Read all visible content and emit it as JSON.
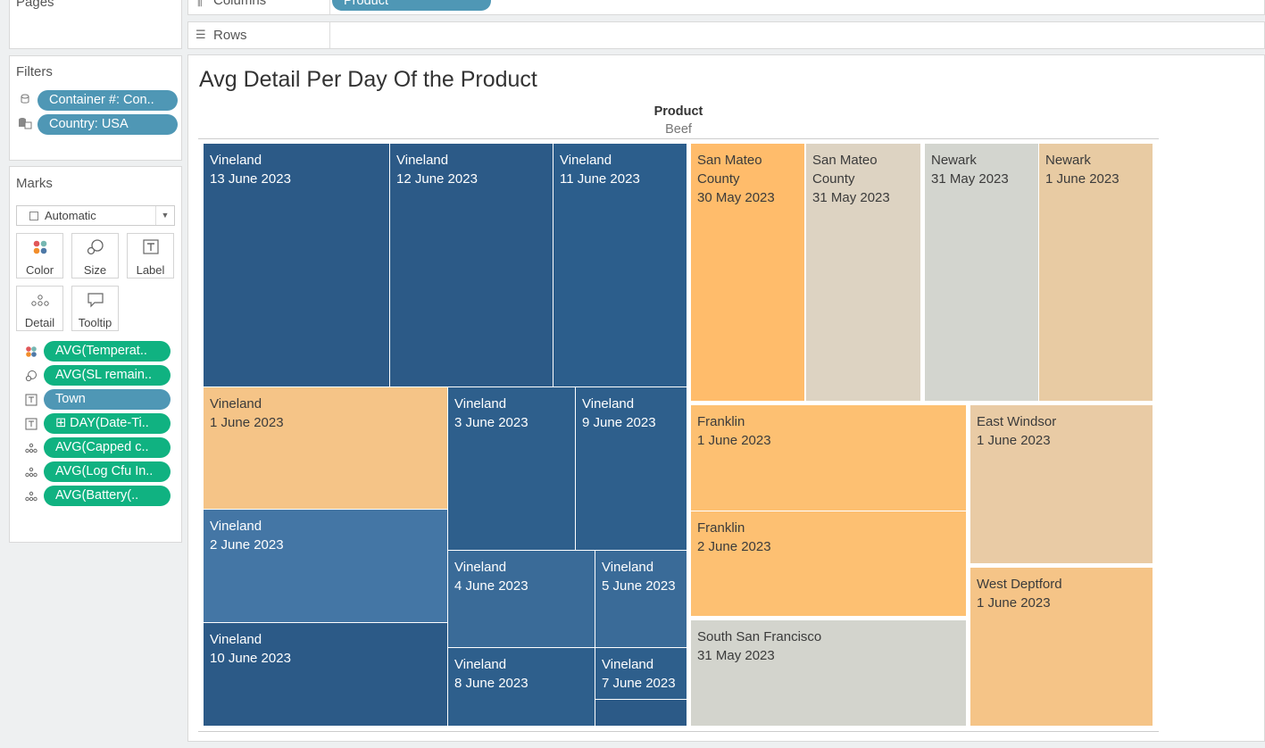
{
  "shelves": {
    "pages_label": "Pages",
    "columns_label": "Columns",
    "columns_pill": "Product",
    "rows_label": "Rows"
  },
  "filters": {
    "title": "Filters",
    "items": [
      "Container #: Con..",
      "Country: USA"
    ]
  },
  "marks": {
    "title": "Marks",
    "type_select": "Automatic",
    "buttons": [
      "Color",
      "Size",
      "Label",
      "Detail",
      "Tooltip"
    ],
    "pills": [
      {
        "icon": "color-icon",
        "label": "AVG(Temperat..",
        "kind": "green"
      },
      {
        "icon": "size-icon",
        "label": "AVG(SL remain..",
        "kind": "green"
      },
      {
        "icon": "label-icon",
        "label": "Town",
        "kind": "blue"
      },
      {
        "icon": "label-icon",
        "label": "⊞ DAY(Date-Ti..",
        "kind": "green"
      },
      {
        "icon": "detail-icon",
        "label": "AVG(Capped c..",
        "kind": "green"
      },
      {
        "icon": "detail-icon",
        "label": "AVG(Log Cfu In..",
        "kind": "green"
      },
      {
        "icon": "detail-icon",
        "label": "AVG(Battery(..",
        "kind": "green"
      }
    ]
  },
  "view": {
    "title": "Avg Detail Per Day Of the Product",
    "header_field": "Product",
    "header_value": "Beef"
  },
  "treemap": [
    {
      "town": "Vineland",
      "date": "13 June 2023",
      "color": "#2c5a87"
    },
    {
      "town": "Vineland",
      "date": "12 June 2023",
      "color": "#2c5a87"
    },
    {
      "town": "Vineland",
      "date": "11 June 2023",
      "color": "#2c5e8c"
    },
    {
      "town": "Vineland",
      "date": "1 June 2023",
      "color": "#f5c487"
    },
    {
      "town": "Vineland",
      "date": "3 June 2023",
      "color": "#2e5f8c"
    },
    {
      "town": "Vineland",
      "date": "9 June 2023",
      "color": "#2e5f8c"
    },
    {
      "town": "Vineland",
      "date": "2 June 2023",
      "color": "#4476a5"
    },
    {
      "town": "Vineland",
      "date": "4 June 2023",
      "color": "#3a6b98"
    },
    {
      "town": "Vineland",
      "date": "5 June 2023",
      "color": "#3a6b98"
    },
    {
      "town": "Vineland",
      "date": "10 June 2023",
      "color": "#2c5a87"
    },
    {
      "town": "Vineland",
      "date": "8 June 2023",
      "color": "#2e5f8c"
    },
    {
      "town": "Vineland",
      "date": "7 June 2023",
      "color": "#2e5f8c"
    },
    {
      "town": "",
      "date": "",
      "color": "#2c5a87"
    },
    {
      "town": "San Mateo County",
      "date": "30 May 2023",
      "color": "#ffbc6b"
    },
    {
      "town": "San Mateo County",
      "date": "31 May 2023",
      "color": "#ddd3c2"
    },
    {
      "town": "Newark",
      "date": "31 May 2023",
      "color": "#d3d5cf"
    },
    {
      "town": "Newark",
      "date": "1 June 2023",
      "color": "#e8cba3"
    },
    {
      "town": "Franklin",
      "date": "1 June 2023",
      "color": "#fdc072"
    },
    {
      "town": "Franklin",
      "date": "2 June 2023",
      "color": "#fdc072"
    },
    {
      "town": "East Windsor",
      "date": "1 June 2023",
      "color": "#e9cba5"
    },
    {
      "town": "West Deptford",
      "date": "1 June 2023",
      "color": "#f5c487"
    },
    {
      "town": "South San Francisco",
      "date": "31 May 2023",
      "color": "#d3d4cd"
    }
  ]
}
